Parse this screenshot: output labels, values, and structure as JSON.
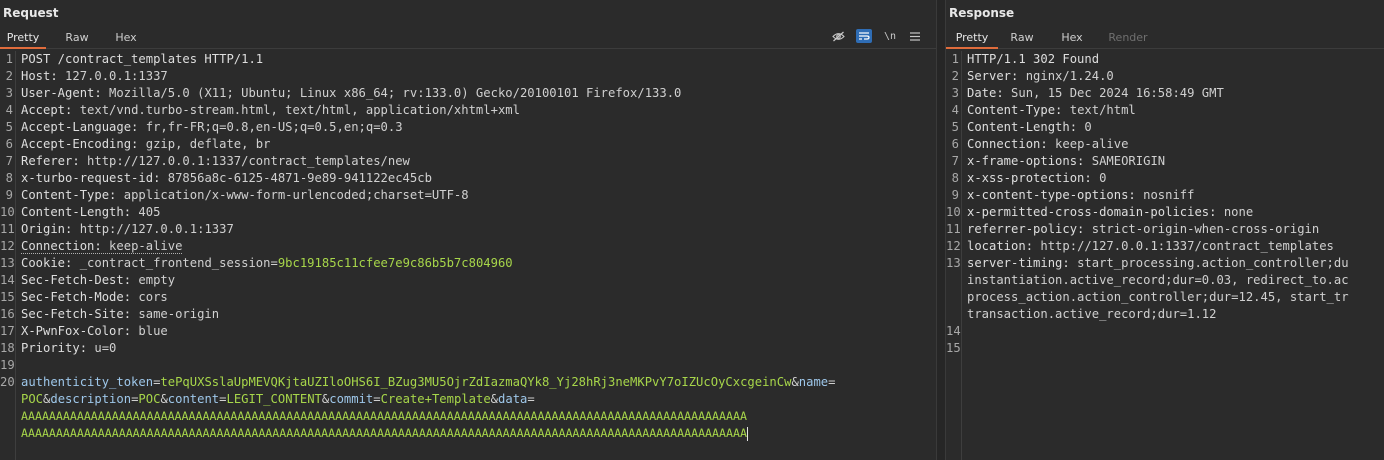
{
  "request": {
    "title": "Request",
    "tabs": [
      "Pretty",
      "Raw",
      "Hex"
    ],
    "icons": [
      "eye-slash-icon",
      "wrap-lines-icon",
      "newline-icon",
      "menu-icon"
    ],
    "newline_glyph": "\\n",
    "line_numbers": [
      "1",
      "2",
      "3",
      "4",
      "5",
      "6",
      "7",
      "8",
      "9",
      "10",
      "11",
      "12",
      "13",
      "14",
      "15",
      "16",
      "17",
      "18",
      "19",
      "20"
    ],
    "headers": [
      {
        "key": "POST /contract_templates HTTP/1.1",
        "value": ""
      },
      {
        "key": "Host:",
        "value": " 127.0.0.1:1337"
      },
      {
        "key": "User-Agent:",
        "value": " Mozilla/5.0 (X11; Ubuntu; Linux x86_64; rv:133.0) Gecko/20100101 Firefox/133.0"
      },
      {
        "key": "Accept:",
        "value": " text/vnd.turbo-stream.html, text/html, application/xhtml+xml"
      },
      {
        "key": "Accept-Language:",
        "value": " fr,fr-FR;q=0.8,en-US;q=0.5,en;q=0.3"
      },
      {
        "key": "Accept-Encoding:",
        "value": " gzip, deflate, br"
      },
      {
        "key": "Referer:",
        "value": " http://127.0.0.1:1337/contract_templates/new"
      },
      {
        "key": "x-turbo-request-id:",
        "value": " 87856a8c-6125-4871-9e89-941122ec45cb"
      },
      {
        "key": "Content-Type:",
        "value": " application/x-www-form-urlencoded;charset=UTF-8"
      },
      {
        "key": "Content-Length:",
        "value": " 405"
      },
      {
        "key": "Origin:",
        "value": " http://127.0.0.1:1337"
      },
      {
        "key": "Connection:",
        "value": " keep-alive"
      },
      {
        "key": "Cookie:",
        "value": " _contract_frontend_session=",
        "cookie_value": "9bc19185c11cfee7e9c86b5b7c804960"
      },
      {
        "key": "Sec-Fetch-Dest:",
        "value": " empty"
      },
      {
        "key": "Sec-Fetch-Mode:",
        "value": " cors"
      },
      {
        "key": "Sec-Fetch-Site:",
        "value": " same-origin"
      },
      {
        "key": "X-PwnFox-Color:",
        "value": " blue"
      },
      {
        "key": "Priority:",
        "value": " u=0"
      }
    ],
    "body": {
      "p1": "authenticity_token",
      "eq": "=",
      "v1": "tePqUXSslaUpMEVQKjtaUZIloOHS6I_BZug3MU5OjrZdIazmaQYk8_Yj28hRj3neMKPvY7oIZUcOyCxcgeinCw",
      "amp": "&",
      "p2": "name",
      "v2": "POC",
      "p3": "description",
      "v3": "POC",
      "p4": "content",
      "v4": "LEGIT_CONTENT",
      "p5": "commit",
      "v5": "Create+Template",
      "p6": "data",
      "v6_line1": "AAAAAAAAAAAAAAAAAAAAAAAAAAAAAAAAAAAAAAAAAAAAAAAAAAAAAAAAAAAAAAAAAAAAAAAAAAAAAAAAAAAAAAAAAAAAAAAAAAAAAAAA",
      "v6_line2": "AAAAAAAAAAAAAAAAAAAAAAAAAAAAAAAAAAAAAAAAAAAAAAAAAAAAAAAAAAAAAAAAAAAAAAAAAAAAAAAAAAAAAAAAAAAAAAAAAAAAAAAA"
    }
  },
  "response": {
    "title": "Response",
    "tabs": [
      "Pretty",
      "Raw",
      "Hex",
      "Render"
    ],
    "line_numbers": [
      "1",
      "2",
      "3",
      "4",
      "5",
      "6",
      "7",
      "8",
      "9",
      "10",
      "11",
      "12",
      "13",
      "14",
      "15"
    ],
    "lines": [
      {
        "key": "HTTP/1.1 302 Found",
        "value": ""
      },
      {
        "key": "Server:",
        "value": " nginx/1.24.0"
      },
      {
        "key": "Date:",
        "value": " Sun, 15 Dec 2024 16:58:49 GMT"
      },
      {
        "key": "Content-Type:",
        "value": " text/html"
      },
      {
        "key": "Content-Length:",
        "value": " 0"
      },
      {
        "key": "Connection:",
        "value": " keep-alive"
      },
      {
        "key": "x-frame-options:",
        "value": " SAMEORIGIN"
      },
      {
        "key": "x-xss-protection:",
        "value": " 0"
      },
      {
        "key": "x-content-type-options:",
        "value": " nosniff"
      },
      {
        "key": "x-permitted-cross-domain-policies:",
        "value": " none"
      },
      {
        "key": "referrer-policy:",
        "value": " strict-origin-when-cross-origin"
      },
      {
        "key": "location:",
        "value": " http://127.0.0.1:1337/contract_templates"
      },
      {
        "key": "server-timing:",
        "value": " start_processing.action_controller;du"
      },
      {
        "key": "",
        "value": "instantiation.active_record;dur=0.03, redirect_to.ac"
      },
      {
        "key": "",
        "value": "process_action.action_controller;dur=12.45, start_tr"
      },
      {
        "key": "",
        "value": "transaction.active_record;dur=1.12"
      }
    ]
  }
}
